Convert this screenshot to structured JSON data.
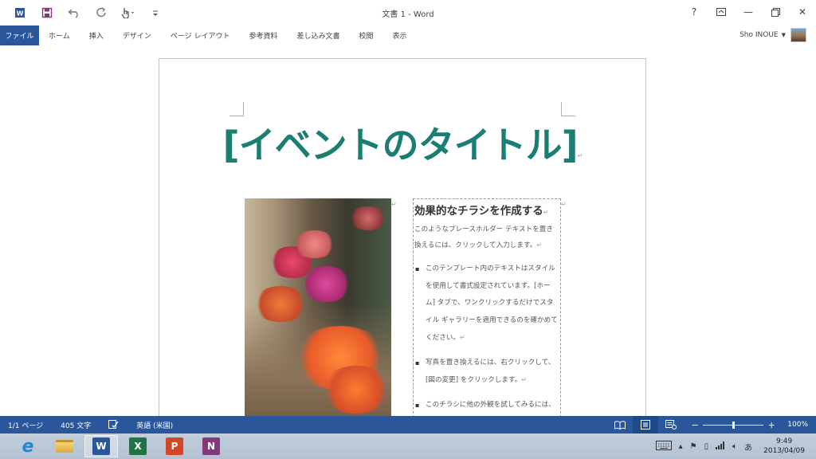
{
  "window": {
    "title": "文書 1 - Word",
    "help_glyph": "?",
    "minimize_glyph": "—",
    "close_glyph": "✕"
  },
  "quick_access": {
    "icons": [
      "word-app-icon",
      "save-icon",
      "undo-icon",
      "redo-icon",
      "touch-mode-icon",
      "customize-qat-icon"
    ]
  },
  "ribbon": {
    "tabs": [
      "ファイル",
      "ホーム",
      "挿入",
      "デザイン",
      "ページ レイアウト",
      "参考資料",
      "差し込み文書",
      "校閲",
      "表示"
    ],
    "user_name": "Sho INOUE"
  },
  "document": {
    "title": "[イベントのタイトル]",
    "paragraph_mark": "↵",
    "heading": "効果的なチラシを作成する",
    "intro": "このようなプレースホルダー テキストを置き換えるには、クリックして入力します。",
    "bullets": [
      "このテンプレート内のテキストはスタイルを使用して書式設定されています。[ホーム] タブで、ワンクリックするだけでスタイル ギャラリーを適用できるのを確かめてください。",
      "写真を置き換えるには、右クリックして、[図の変更] をクリックします。",
      "このチラシに他の外観を試してみるには、[デザイン] タブで、テーマ、色、フォント ギャラリーをチェックします。"
    ]
  },
  "status": {
    "page": "1/1 ページ",
    "words": "405 文字",
    "language": "英語 (米国)",
    "zoom_minus": "−",
    "zoom_plus": "+",
    "zoom": "100%",
    "zoom_fraction": 0.5
  },
  "taskbar": {
    "apps": [
      {
        "name": "internet-explorer",
        "label": "e",
        "color": "#1e88d6"
      },
      {
        "name": "file-explorer",
        "label": "",
        "color": "#e8b84a"
      },
      {
        "name": "word",
        "label": "W",
        "color": "#2b579a"
      },
      {
        "name": "excel",
        "label": "X",
        "color": "#217346"
      },
      {
        "name": "powerpoint",
        "label": "P",
        "color": "#d24726"
      },
      {
        "name": "onenote",
        "label": "N",
        "color": "#80397b"
      }
    ],
    "ime": "あ",
    "time": "9:49",
    "date": "2013/04/09"
  },
  "colors": {
    "accent": "#2b579a",
    "title_teal": "#1a7f72"
  }
}
